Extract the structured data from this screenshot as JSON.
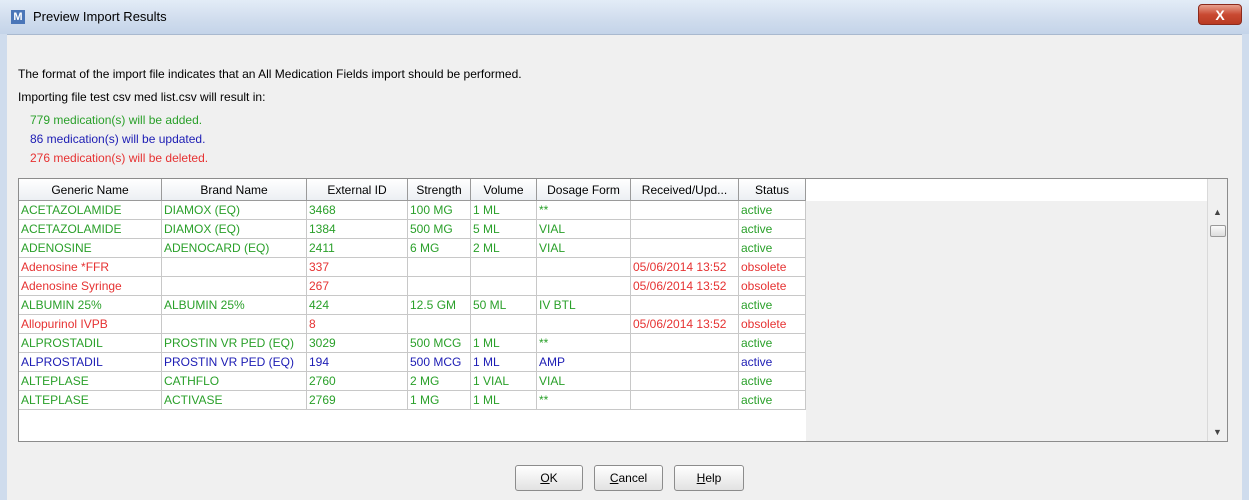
{
  "window": {
    "title": "Preview Import Results",
    "app_icon": "M",
    "close_glyph": "X"
  },
  "messages": {
    "format_line": "The format of the import file indicates that an All Medication Fields import should be performed.",
    "importing_line": "Importing file test csv med list.csv will result in:"
  },
  "summary": {
    "added": "779 medication(s) will be added.",
    "updated": "86 medication(s) will be updated.",
    "deleted": "276 medication(s) will be deleted."
  },
  "colors": {
    "added": "#2aa02a",
    "updated": "#1c1cb4",
    "deleted": "#e63232"
  },
  "table": {
    "columns": [
      "Generic Name",
      "Brand Name",
      "External ID",
      "Strength",
      "Volume",
      "Dosage Form",
      "Received/Upd...",
      "Status"
    ],
    "rows": [
      {
        "kind": "added",
        "cells": [
          "ACETAZOLAMIDE",
          "DIAMOX (EQ)",
          "3468",
          "100 MG",
          "1 ML",
          "**",
          "",
          "active"
        ]
      },
      {
        "kind": "added",
        "cells": [
          "ACETAZOLAMIDE",
          "DIAMOX (EQ)",
          "1384",
          "500 MG",
          "5 ML",
          "VIAL",
          "",
          "active"
        ]
      },
      {
        "kind": "added",
        "cells": [
          "ADENOSINE",
          "ADENOCARD (EQ)",
          "2411",
          "6 MG",
          "2 ML",
          "VIAL",
          "",
          "active"
        ]
      },
      {
        "kind": "deleted",
        "cells": [
          "Adenosine *FFR",
          "",
          "337",
          "",
          "",
          "",
          "05/06/2014 13:52",
          "obsolete"
        ]
      },
      {
        "kind": "deleted",
        "cells": [
          "Adenosine Syringe",
          "",
          "267",
          "",
          "",
          "",
          "05/06/2014 13:52",
          "obsolete"
        ]
      },
      {
        "kind": "added",
        "cells": [
          "ALBUMIN 25%",
          "ALBUMIN 25%",
          "424",
          "12.5 GM",
          "50 ML",
          "IV BTL",
          "",
          "active"
        ]
      },
      {
        "kind": "deleted",
        "cells": [
          "Allopurinol IVPB",
          "",
          "8",
          "",
          "",
          "",
          "05/06/2014 13:52",
          "obsolete"
        ]
      },
      {
        "kind": "added",
        "cells": [
          "ALPROSTADIL",
          "PROSTIN VR PED (EQ)",
          "3029",
          "500 MCG",
          "1 ML",
          "**",
          "",
          "active"
        ]
      },
      {
        "kind": "updated",
        "cells": [
          "ALPROSTADIL",
          "PROSTIN VR PED (EQ)",
          "194",
          "500 MCG",
          "1 ML",
          "AMP",
          "",
          "active"
        ]
      },
      {
        "kind": "added",
        "cells": [
          "ALTEPLASE",
          "CATHFLO",
          "2760",
          "2 MG",
          "1 VIAL",
          "VIAL",
          "",
          "active"
        ]
      },
      {
        "kind": "added",
        "cells": [
          "ALTEPLASE",
          "ACTIVASE",
          "2769",
          "1 MG",
          "1 ML",
          "**",
          "",
          "active"
        ]
      }
    ]
  },
  "buttons": {
    "ok": {
      "mnemonic": "O",
      "rest": "K"
    },
    "cancel": {
      "mnemonic": "C",
      "rest": "ancel"
    },
    "help": {
      "mnemonic": "H",
      "rest": "elp"
    }
  }
}
